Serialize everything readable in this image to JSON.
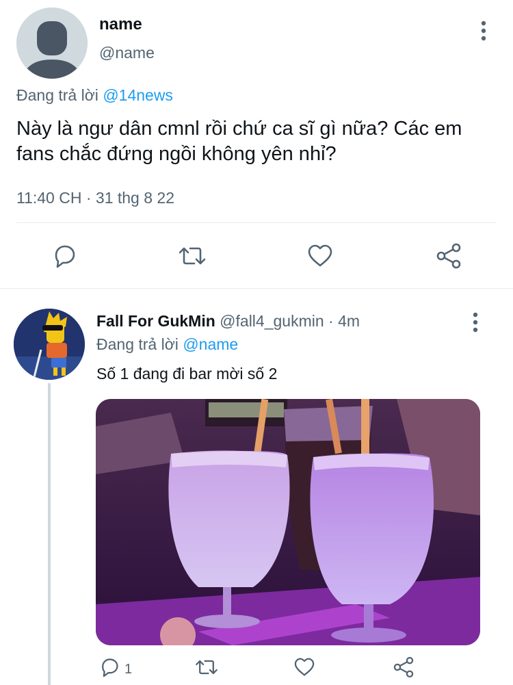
{
  "main_tweet": {
    "display_name": "name",
    "handle": "@name",
    "replying_prefix": "Đang trả lời",
    "replying_to": "@14news",
    "text": "Này là ngư dân cmnl rồi chứ ca sĩ gì nữa? Các em fans chắc đứng ngồi không yên nhỉ?",
    "timestamp": "11:40 CH · 31 thg 8 22",
    "actions": [
      "reply-icon",
      "retweet-icon",
      "like-icon",
      "share-icon"
    ]
  },
  "reply_tweet": {
    "display_name": "Fall For GukMin",
    "handle_time": "@fall4_gukmin · 4m",
    "replying_prefix": "Đang trả lời",
    "replying_to": "@name",
    "text": "Số 1 đang đi bar mời số 2",
    "reply_count": "1",
    "media": "photo of purple cocktails with straws",
    "actions": [
      "reply-icon",
      "retweet-icon",
      "like-icon",
      "share-icon"
    ]
  },
  "colors": {
    "text": "#0f1419",
    "muted": "#536471",
    "link": "#1d9bf0",
    "divider": "#e6ecf0",
    "placeholder_avatar": "#cfd9de"
  }
}
